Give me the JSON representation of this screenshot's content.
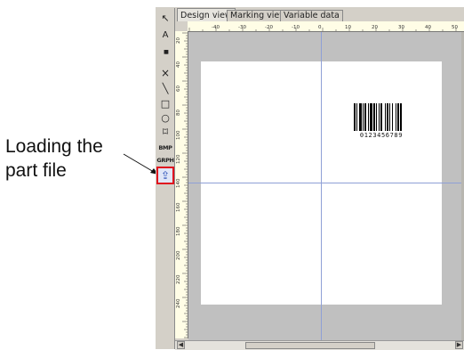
{
  "callout": {
    "line1": "Loading the",
    "line2": "part file"
  },
  "tabs": [
    {
      "label": "Design view",
      "active": true
    },
    {
      "label": "Marking view",
      "active": false
    },
    {
      "label": "Variable data",
      "active": false
    }
  ],
  "toolbar": {
    "tools": [
      {
        "name": "select-arrow-icon",
        "glyph": "↖"
      },
      {
        "name": "text-tool-icon",
        "glyph": "A"
      },
      {
        "name": "barcode-tool-icon",
        "glyph": "▮▮▮"
      },
      {
        "name": "cross-tool-icon",
        "glyph": "×"
      },
      {
        "name": "line-tool-icon",
        "glyph": "╲"
      },
      {
        "name": "rectangle-tool-icon",
        "glyph": "□"
      },
      {
        "name": "ellipse-tool-icon",
        "glyph": "○"
      },
      {
        "name": "polygon-tool-icon",
        "glyph": "⌑"
      },
      {
        "name": "bmp-tool-icon",
        "glyph": "BMP"
      },
      {
        "name": "graph-tool-icon",
        "glyph": "GRPH"
      },
      {
        "name": "load-part-file-icon",
        "glyph": "⇪"
      }
    ]
  },
  "ruler": {
    "top_labels": [
      "-40",
      "-30",
      "-20",
      "-10",
      "0",
      "10",
      "20",
      "30",
      "40",
      "50"
    ],
    "left_labels": [
      "20",
      "40",
      "60",
      "80",
      "100",
      "120",
      "140",
      "160",
      "180",
      "200",
      "220",
      "240"
    ]
  },
  "barcode": {
    "digits": "0123456789"
  },
  "colors": {
    "highlight": "#e0141e",
    "guide": "#8fa0d6",
    "ruler": "#fffde6"
  }
}
